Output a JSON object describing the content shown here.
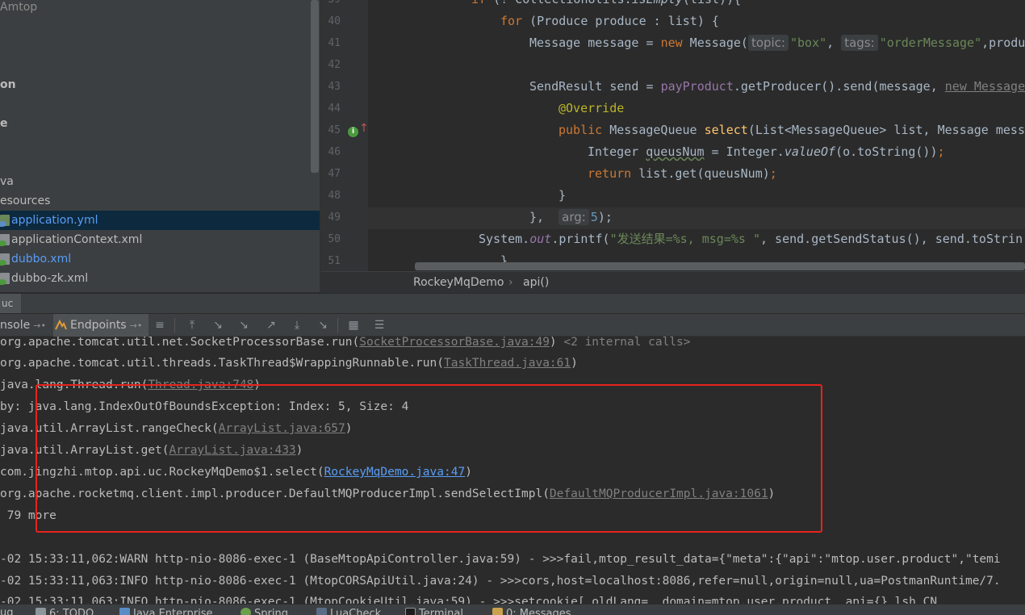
{
  "project_tree": {
    "items": [
      {
        "label": "Amtop",
        "style": "normal"
      },
      {
        "label": "on",
        "style": "bold"
      },
      {
        "label": "e",
        "style": "bold"
      },
      {
        "label": "va",
        "style": "normal"
      },
      {
        "label": "esources",
        "style": "normal"
      },
      {
        "label": "application.yml",
        "style": "selected"
      },
      {
        "label": "applicationContext.xml",
        "style": "normal"
      },
      {
        "label": "dubbo.xml",
        "style": "blue"
      },
      {
        "label": "dubbo-zk.xml",
        "style": "normal"
      }
    ]
  },
  "editor": {
    "line_numbers": [
      "39",
      "40",
      "41",
      "42",
      "43",
      "44",
      "45",
      "46",
      "47",
      "48",
      "49",
      "50",
      "51"
    ],
    "lines": {
      "l39": {
        "kw": "if",
        "a": " (! CollectionUtils.",
        "fn": "isEmpty",
        "b": "(list)){"
      },
      "l40": {
        "kw": "for",
        "a": " (Produce produce : list) {"
      },
      "l41": {
        "a": "Message message = ",
        "kw": "new",
        "b": " Message(",
        "hint1": "topic:",
        "s1": "\"box\"",
        "c": ", ",
        "hint2": "tags:",
        "s2": "\"orderMessage\"",
        "d": ",produ"
      },
      "l43": {
        "a": "SendResult send = ",
        "fld": "payProduct",
        "b": ".getProducer().send(message, ",
        "c": "new MessageQ"
      },
      "l44": {
        "ann": "@Override"
      },
      "l45": {
        "kw": "public",
        "a": " MessageQueue ",
        "fn": "select",
        "b": "(List<MessageQueue> list, Message messa"
      },
      "l46": {
        "a": "Integer ",
        "w": "queusNum",
        "b": " = Integer.",
        "fn": "valueOf",
        "c": "(o.toString())",
        "d": ";"
      },
      "l47": {
        "kw": "return",
        "a": " list.get(queusNum)",
        "b": ";"
      },
      "l48": {
        "a": "}"
      },
      "l49": {
        "a": "},  ",
        "hint": "arg:",
        "num": "5",
        "b": ");"
      },
      "l50": {
        "a": "System.",
        "fld": "out",
        "b": ".printf(",
        "s": "\"发送结果=%s, msg=%s \"",
        "c": ", send.getSendStatus(), send.toStrin"
      },
      "l51": {
        "a": "}"
      }
    }
  },
  "breadcrumb": {
    "class_name": "RockeyMqDemo",
    "method": "api()"
  },
  "run_strip": {
    "tab": "uc"
  },
  "console_toolbar": {
    "console_tab": "nsole",
    "endpoints_tab": "Endpoints"
  },
  "console": {
    "lines": [
      {
        "pre": "org.apache.tomcat.util.net.SocketProcessorBase.run(",
        "link": "SocketProcessorBase.java:49",
        "post": ")",
        "gray": " <2 internal calls>"
      },
      {
        "pre": "org.apache.tomcat.util.threads.TaskThread$WrappingRunnable.run(",
        "link": "TaskThread.java:61",
        "post": ")"
      },
      {
        "pre": "java.lang.Thread.run(",
        "link": "Thread.java:748",
        "post": ")"
      },
      {
        "pre": "by: java.lang.IndexOutOfBoundsException: Index: 5, Size: 4"
      },
      {
        "pre": "java.util.ArrayList.rangeCheck(",
        "link": "ArrayList.java:657",
        "post": ")"
      },
      {
        "pre": "java.util.ArrayList.get(",
        "link": "ArrayList.java:433",
        "post": ")"
      },
      {
        "pre": "com.jingzhi.mtop.api.uc.RockeyMqDemo$1.select(",
        "link": "RockeyMqDemo.java:47",
        "post": ")",
        "blue": true
      },
      {
        "pre": "org.apache.rocketmq.client.impl.producer.DefaultMQProducerImpl.sendSelectImpl(",
        "link": "DefaultMQProducerImpl.java:1061",
        "post": ")"
      },
      {
        "pre": " 79 more"
      },
      {
        "pre": ""
      },
      {
        "pre": "-02 15:33:11,062:WARN http-nio-8086-exec-1 (BaseMtopApiController.java:59) - >>>fail,mtop_result_data={\"meta\":{\"api\":\"mtop.user.product\",\"temi"
      },
      {
        "pre": "-02 15:33:11,063:INFO http-nio-8086-exec-1 (MtopCORSApiUtil.java:24) - >>>cors,host=localhost:8086,refer=null,origin=null,ua=PostmanRuntime/7."
      },
      {
        "pre": "-02 15:33:11,063:INFO http-nio-8086-exec-1 (MtopCookieUtil.java:59) - >>>setcookie[ oldLang=  domain=mtop.user.product  api={} lsh_CN"
      }
    ]
  },
  "bottom_bar": {
    "items": [
      "ug",
      "6: TODO",
      "Java Enterprise",
      "Spring",
      "LuaCheck",
      "Terminal",
      "0: Messages"
    ]
  }
}
